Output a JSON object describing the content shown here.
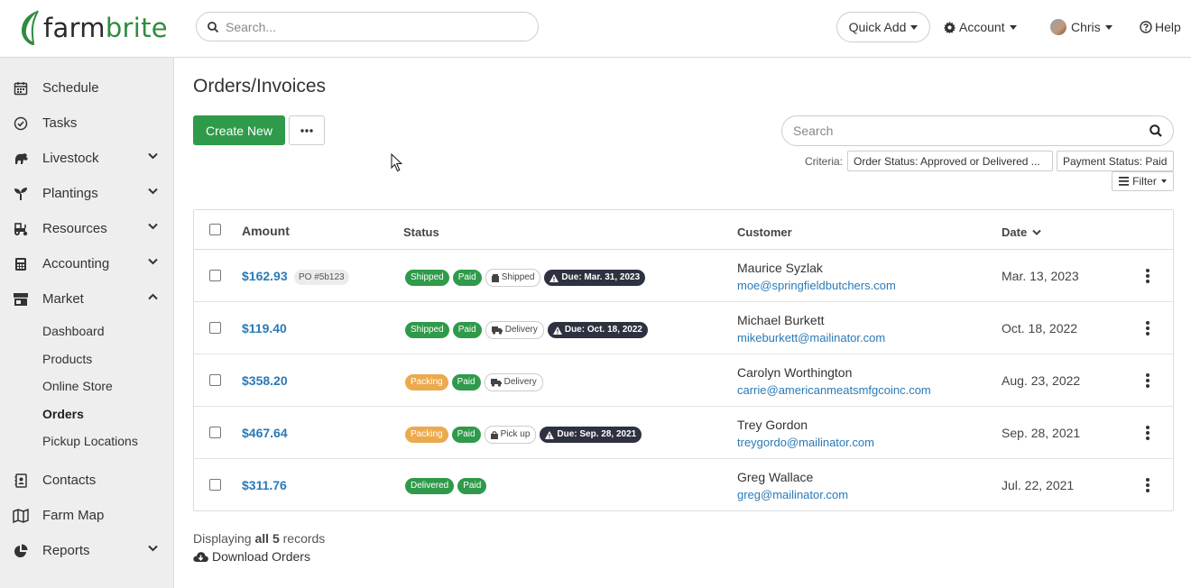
{
  "brand": {
    "name_part1": "farm",
    "name_part2": "brite",
    "accent": "#2f9a4a"
  },
  "topbar": {
    "search_placeholder": "Search...",
    "quick_add": "Quick Add",
    "account": "Account",
    "user": "Chris",
    "help": "Help"
  },
  "sidebar": {
    "items": [
      {
        "label": "Schedule",
        "icon": "calendar-icon"
      },
      {
        "label": "Tasks",
        "icon": "check-circle-icon"
      },
      {
        "label": "Livestock",
        "icon": "livestock-icon"
      },
      {
        "label": "Plantings",
        "icon": "seedling-icon"
      },
      {
        "label": "Resources",
        "icon": "tractor-icon"
      },
      {
        "label": "Accounting",
        "icon": "calculator-icon"
      },
      {
        "label": "Market",
        "icon": "store-icon"
      },
      {
        "label": "Contacts",
        "icon": "address-book-icon"
      },
      {
        "label": "Farm Map",
        "icon": "map-icon"
      },
      {
        "label": "Reports",
        "icon": "pie-chart-icon"
      }
    ],
    "market_sub": [
      "Dashboard",
      "Products",
      "Online Store",
      "Orders",
      "Pickup Locations"
    ]
  },
  "main": {
    "title": "Orders/Invoices",
    "create_new": "Create New",
    "search_placeholder": "Search",
    "criteria_label": "Criteria:",
    "criteria": [
      "Order Status: Approved or Delivered ...",
      "Payment Status: Paid"
    ],
    "filter": "Filter"
  },
  "table": {
    "headers": {
      "amount": "Amount",
      "status": "Status",
      "customer": "Customer",
      "date": "Date"
    },
    "rows": [
      {
        "amount": "$162.93",
        "po": "PO #5b123",
        "status": "Shipped",
        "payment": "Paid",
        "method": "Shipped",
        "due": "Due: Mar. 31, 2023",
        "name": "Maurice Syzlak",
        "email": "moe@springfieldbutchers.com",
        "date": "Mar. 13, 2023"
      },
      {
        "amount": "$119.40",
        "po": "",
        "status": "Shipped",
        "payment": "Paid",
        "method": "Delivery",
        "due": "Due: Oct. 18, 2022",
        "name": "Michael Burkett",
        "email": "mikeburkett@mailinator.com",
        "date": "Oct. 18, 2022"
      },
      {
        "amount": "$358.20",
        "po": "",
        "status": "Packing",
        "payment": "Paid",
        "method": "Delivery",
        "due": "",
        "name": "Carolyn Worthington",
        "email": "carrie@americanmeatsmfgcoinc.com",
        "date": "Aug. 23, 2022"
      },
      {
        "amount": "$467.64",
        "po": "",
        "status": "Packing",
        "payment": "Paid",
        "method": "Pick up",
        "due": "Due: Sep. 28, 2021",
        "name": "Trey Gordon",
        "email": "treygordo@mailinator.com",
        "date": "Sep. 28, 2021"
      },
      {
        "amount": "$311.76",
        "po": "",
        "status": "Delivered",
        "payment": "Paid",
        "method": "",
        "due": "",
        "name": "Greg Wallace",
        "email": "greg@mailinator.com",
        "date": "Jul. 22, 2021"
      }
    ]
  },
  "footer": {
    "displaying_prefix": "Displaying",
    "displaying_bold": "all 5",
    "displaying_suffix": "records",
    "download": "Download Orders"
  }
}
